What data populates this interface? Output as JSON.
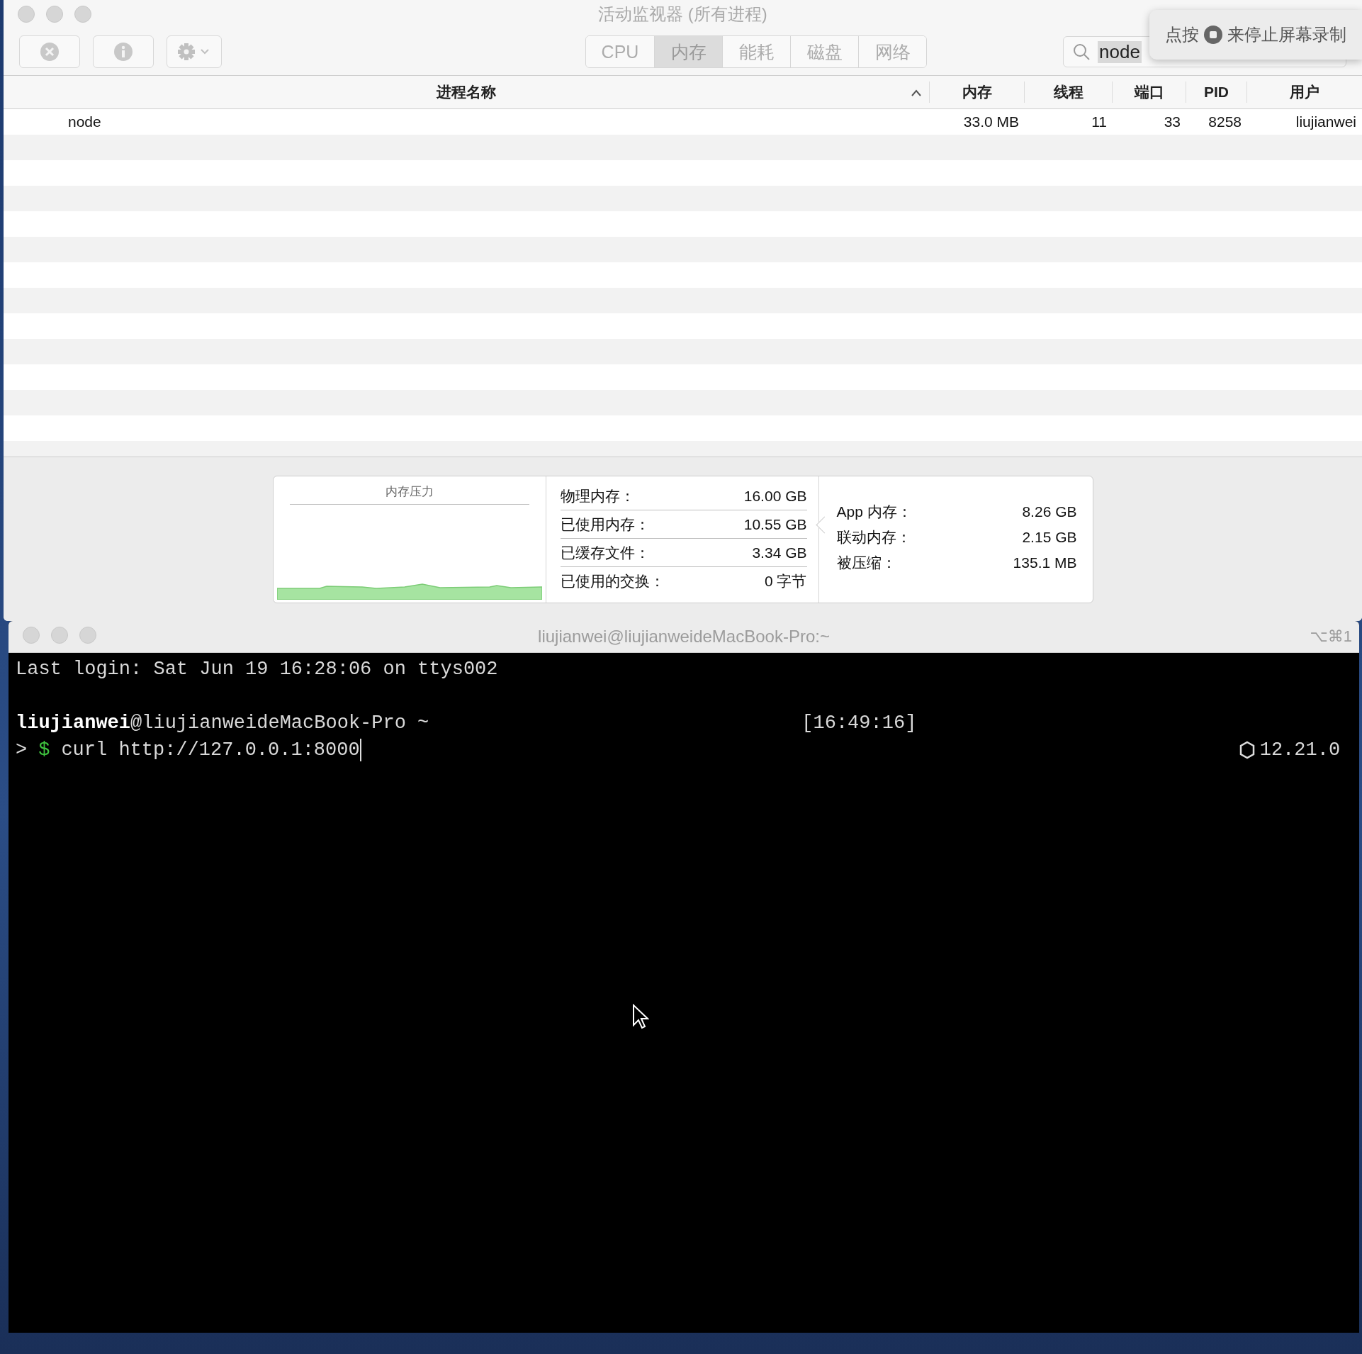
{
  "activity_monitor": {
    "title": "活动监视器 (所有进程)",
    "tabs": [
      {
        "label": "CPU",
        "selected": false
      },
      {
        "label": "内存",
        "selected": true
      },
      {
        "label": "能耗",
        "selected": false
      },
      {
        "label": "磁盘",
        "selected": false
      },
      {
        "label": "网络",
        "selected": false
      }
    ],
    "search": {
      "value": "node"
    },
    "table": {
      "columns": [
        {
          "label": "进程名称",
          "sorted": true
        },
        {
          "label": "内存",
          "sorted": false
        },
        {
          "label": "线程",
          "sorted": false
        },
        {
          "label": "端口",
          "sorted": false
        },
        {
          "label": "PID",
          "sorted": false
        },
        {
          "label": "用户",
          "sorted": false
        }
      ],
      "rows": [
        {
          "cells": [
            "node",
            "33.0 MB",
            "11",
            "33",
            "8258",
            "liujianwei"
          ]
        }
      ]
    },
    "memory": {
      "pressure_title": "内存压力",
      "stats": [
        {
          "label": "物理内存：",
          "value": "16.00 GB"
        },
        {
          "label": "已使用内存：",
          "value": "10.55 GB"
        },
        {
          "label": "已缓存文件：",
          "value": "3.34 GB"
        },
        {
          "label": "已使用的交换：",
          "value": "0 字节"
        }
      ],
      "details": [
        {
          "label": "App 内存：",
          "value": "8.26 GB"
        },
        {
          "label": "联动内存：",
          "value": "2.15 GB"
        },
        {
          "label": "被压缩：",
          "value": "135.1 MB"
        }
      ]
    }
  },
  "recording_hint": {
    "before": "点按",
    "after": "来停止屏幕录制"
  },
  "terminal": {
    "title": "liujianwei@liujianweideMacBook-Pro:~",
    "shortcut": "⌥⌘1",
    "last_login": "Last login: Sat Jun 19 16:28:06 on ttys002",
    "prompt": {
      "user": "liujianwei",
      "host": "@liujianweideMacBook-Pro ~",
      "time": "[16:49:16]",
      "arrow": ">",
      "dollar": "$",
      "command": "curl http://127.0.0.1:8000",
      "node_version": "12.21.0"
    }
  }
}
